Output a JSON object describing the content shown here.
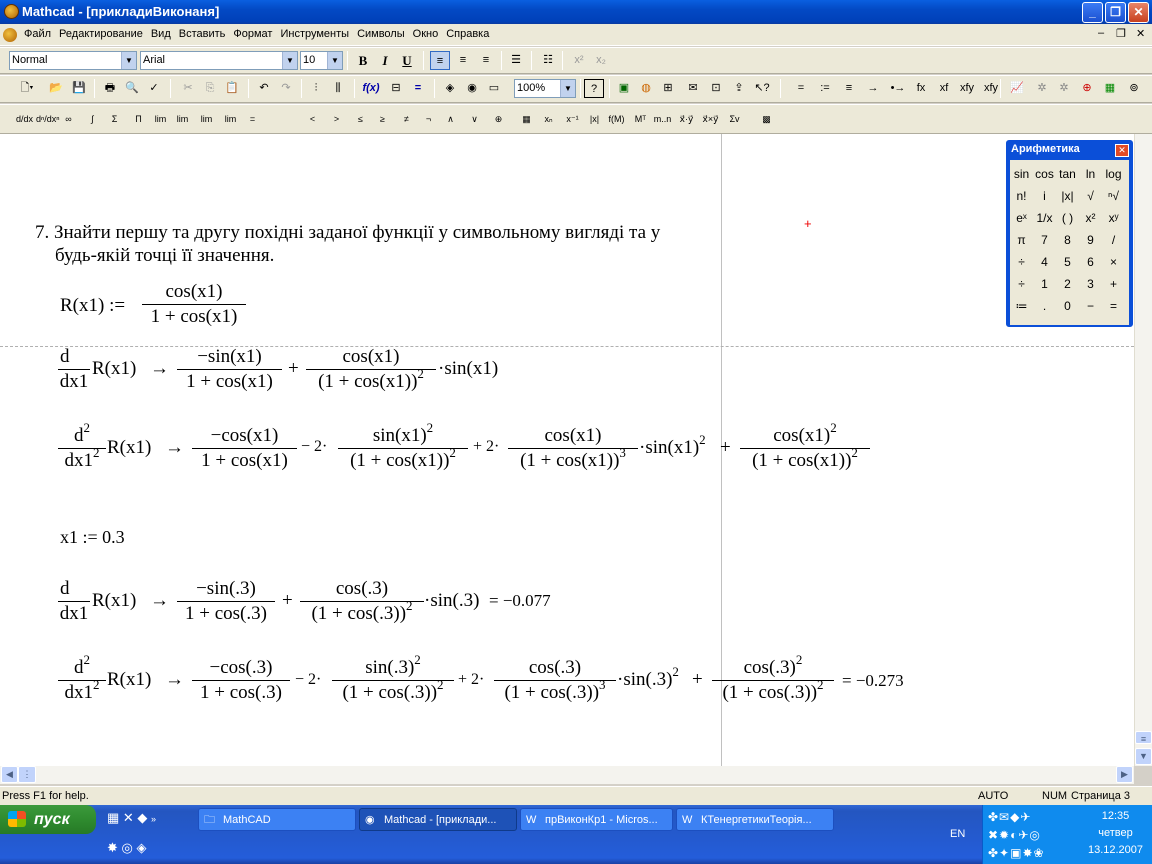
{
  "window": {
    "title": "Mathcad - [прикладиВиконаня]"
  },
  "menu": [
    "Файл",
    "Редактирование",
    "Вид",
    "Вставить",
    "Формат",
    "Инструменты",
    "Символы",
    "Окно",
    "Справка"
  ],
  "format_bar": {
    "style": "Normal",
    "font": "Arial",
    "size": "10",
    "bold": "B",
    "italic": "I",
    "underline": "U"
  },
  "standard_bar": {
    "zoom": "100%"
  },
  "math_bar": {
    "ops": [
      "=",
      ":=",
      "≡",
      "→",
      "•→",
      "fx",
      "xf",
      "xfy",
      "xfy"
    ]
  },
  "task_text": {
    "line1": "7. Знайти першу та другу похідні заданої функції у символьному вигляді та у",
    "line2": "будь-якій точці її значення."
  },
  "eq": {
    "def_lhs": "R(x1)  :=",
    "def_num": "cos(x1)",
    "def_den": "1 + cos(x1)",
    "d": "d",
    "dx": "dx1",
    "d2": "d",
    "dx2": "dx1",
    "Rx": "R(x1)",
    "arrow": "→",
    "t1n": "−sin(x1)",
    "t1d": "1 + cos(x1)",
    "plus": "+",
    "t2n": "cos(x1)",
    "t2d": "(1 + cos(x1))",
    "sinx": "·sin(x1)",
    "s1n": "−cos(x1)",
    "s1d": "1 + cos(x1)",
    "m2": "− 2·",
    "s2n": "sin(x1)",
    "s2d": "(1 + cos(x1))",
    "p2": "+ 2·",
    "s3n": "cos(x1)",
    "s3d": "(1 + cos(x1))",
    "sinx2": "·sin(x1)",
    "p4": "+",
    "s4n": "cos(x1)",
    "s4d": "(1 + cos(x1))",
    "x1def": "x1  :=  0.3",
    "u1n": "−sin(.3)",
    "u1d": "1 + cos(.3)",
    "u2n": "cos(.3)",
    "u2d": "(1 + cos(.3))",
    "usin": "·sin(.3)",
    "res1": "=  −0.077",
    "v1n": "−cos(.3)",
    "v1d": "1 + cos(.3)",
    "v2n": "sin(.3)",
    "v2d": "(1 + cos(.3))",
    "v3n": "cos(.3)",
    "v3d": "(1 + cos(.3))",
    "vsin": "·sin(.3)",
    "v4n": "cos(.3)",
    "v4d": "(1 + cos(.3))",
    "res2": "=  −0.273"
  },
  "palette": {
    "title": "Арифметика",
    "keys": [
      "sin",
      "cos",
      "tan",
      "ln",
      "log",
      "n!",
      "i",
      "|x|",
      "√",
      "ⁿ√",
      "eˣ",
      "1/x",
      "( )",
      "x²",
      "xʸ",
      "π",
      "7",
      "8",
      "9",
      "/",
      "÷",
      "4",
      "5",
      "6",
      "×",
      "÷",
      "1",
      "2",
      "3",
      "+",
      "≔",
      ".",
      "0",
      "−",
      "="
    ]
  },
  "status": {
    "help": "Press F1 for help.",
    "auto": "AUTO",
    "num": "NUM",
    "page": "Страница 3"
  },
  "taskbar": {
    "start": "пуск",
    "items": [
      "MathCAD",
      "Mathcad - [приклади...",
      "прВиконКр1 - Micros...",
      "КТенергетикиТеорія..."
    ],
    "lang": "EN",
    "time": "12:35",
    "day": "четвер",
    "date": "13.12.2007"
  }
}
